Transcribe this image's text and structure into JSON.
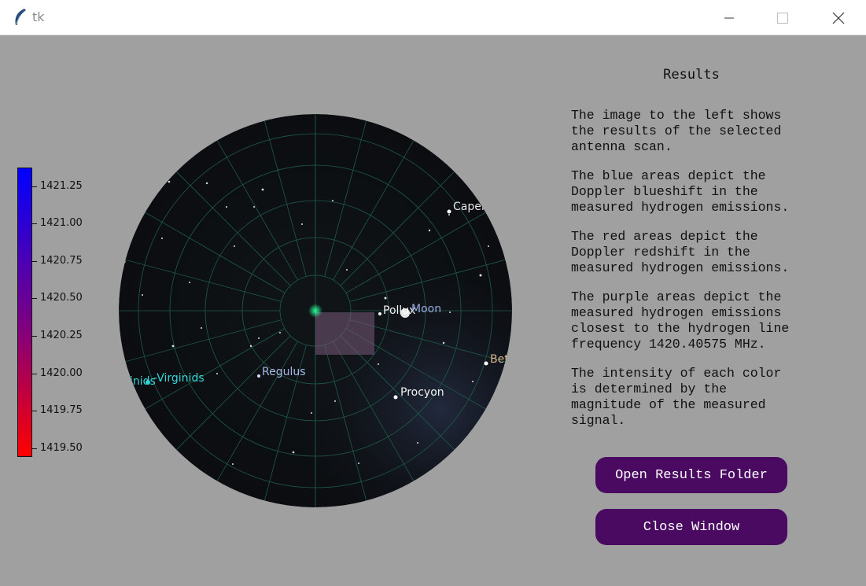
{
  "window": {
    "title": "tk",
    "minimize_icon": "minimize-icon",
    "maximize_icon": "maximize-icon",
    "close_icon": "close-icon"
  },
  "colorbar": {
    "ticks": [
      "1421.25",
      "1421.00",
      "1420.75",
      "1420.50",
      "1420.25",
      "1420.00",
      "1419.75",
      "1419.50"
    ],
    "top_color": "#0000ff",
    "middle_color": "#7f0080",
    "bottom_color": "#ff0000"
  },
  "sky": {
    "labels": {
      "capella": "Capel",
      "pollux": "Pollux",
      "moon": "Moon",
      "betelgeuse": "Bet",
      "regulus": "Regulus",
      "procyon": "Procyon",
      "virginids": "-Virginids",
      "virginids_left": "inids",
      "edge_s": "s"
    },
    "overlay_color": "#7a5a7a"
  },
  "results": {
    "title": "Results",
    "paragraphs": [
      "The image to the left shows\nthe results of the selected\nantenna scan.",
      "The blue areas depict the\nDoppler blueshift in the\nmeasured hydrogen emissions.",
      "The red areas depict the\nDoppler redshift in the\nmeasured hydrogen emissions.",
      "The purple areas depict the\nmeasured hydrogen emissions\nclosest to the hydrogen line\nfrequency 1420.40575 MHz.",
      "The intensity of each color\nis determined by the\nmagnitude of the measured\nsignal."
    ]
  },
  "buttons": {
    "open_folder": "Open Results Folder",
    "close_window": "Close Window",
    "color": "#4a0a62"
  }
}
